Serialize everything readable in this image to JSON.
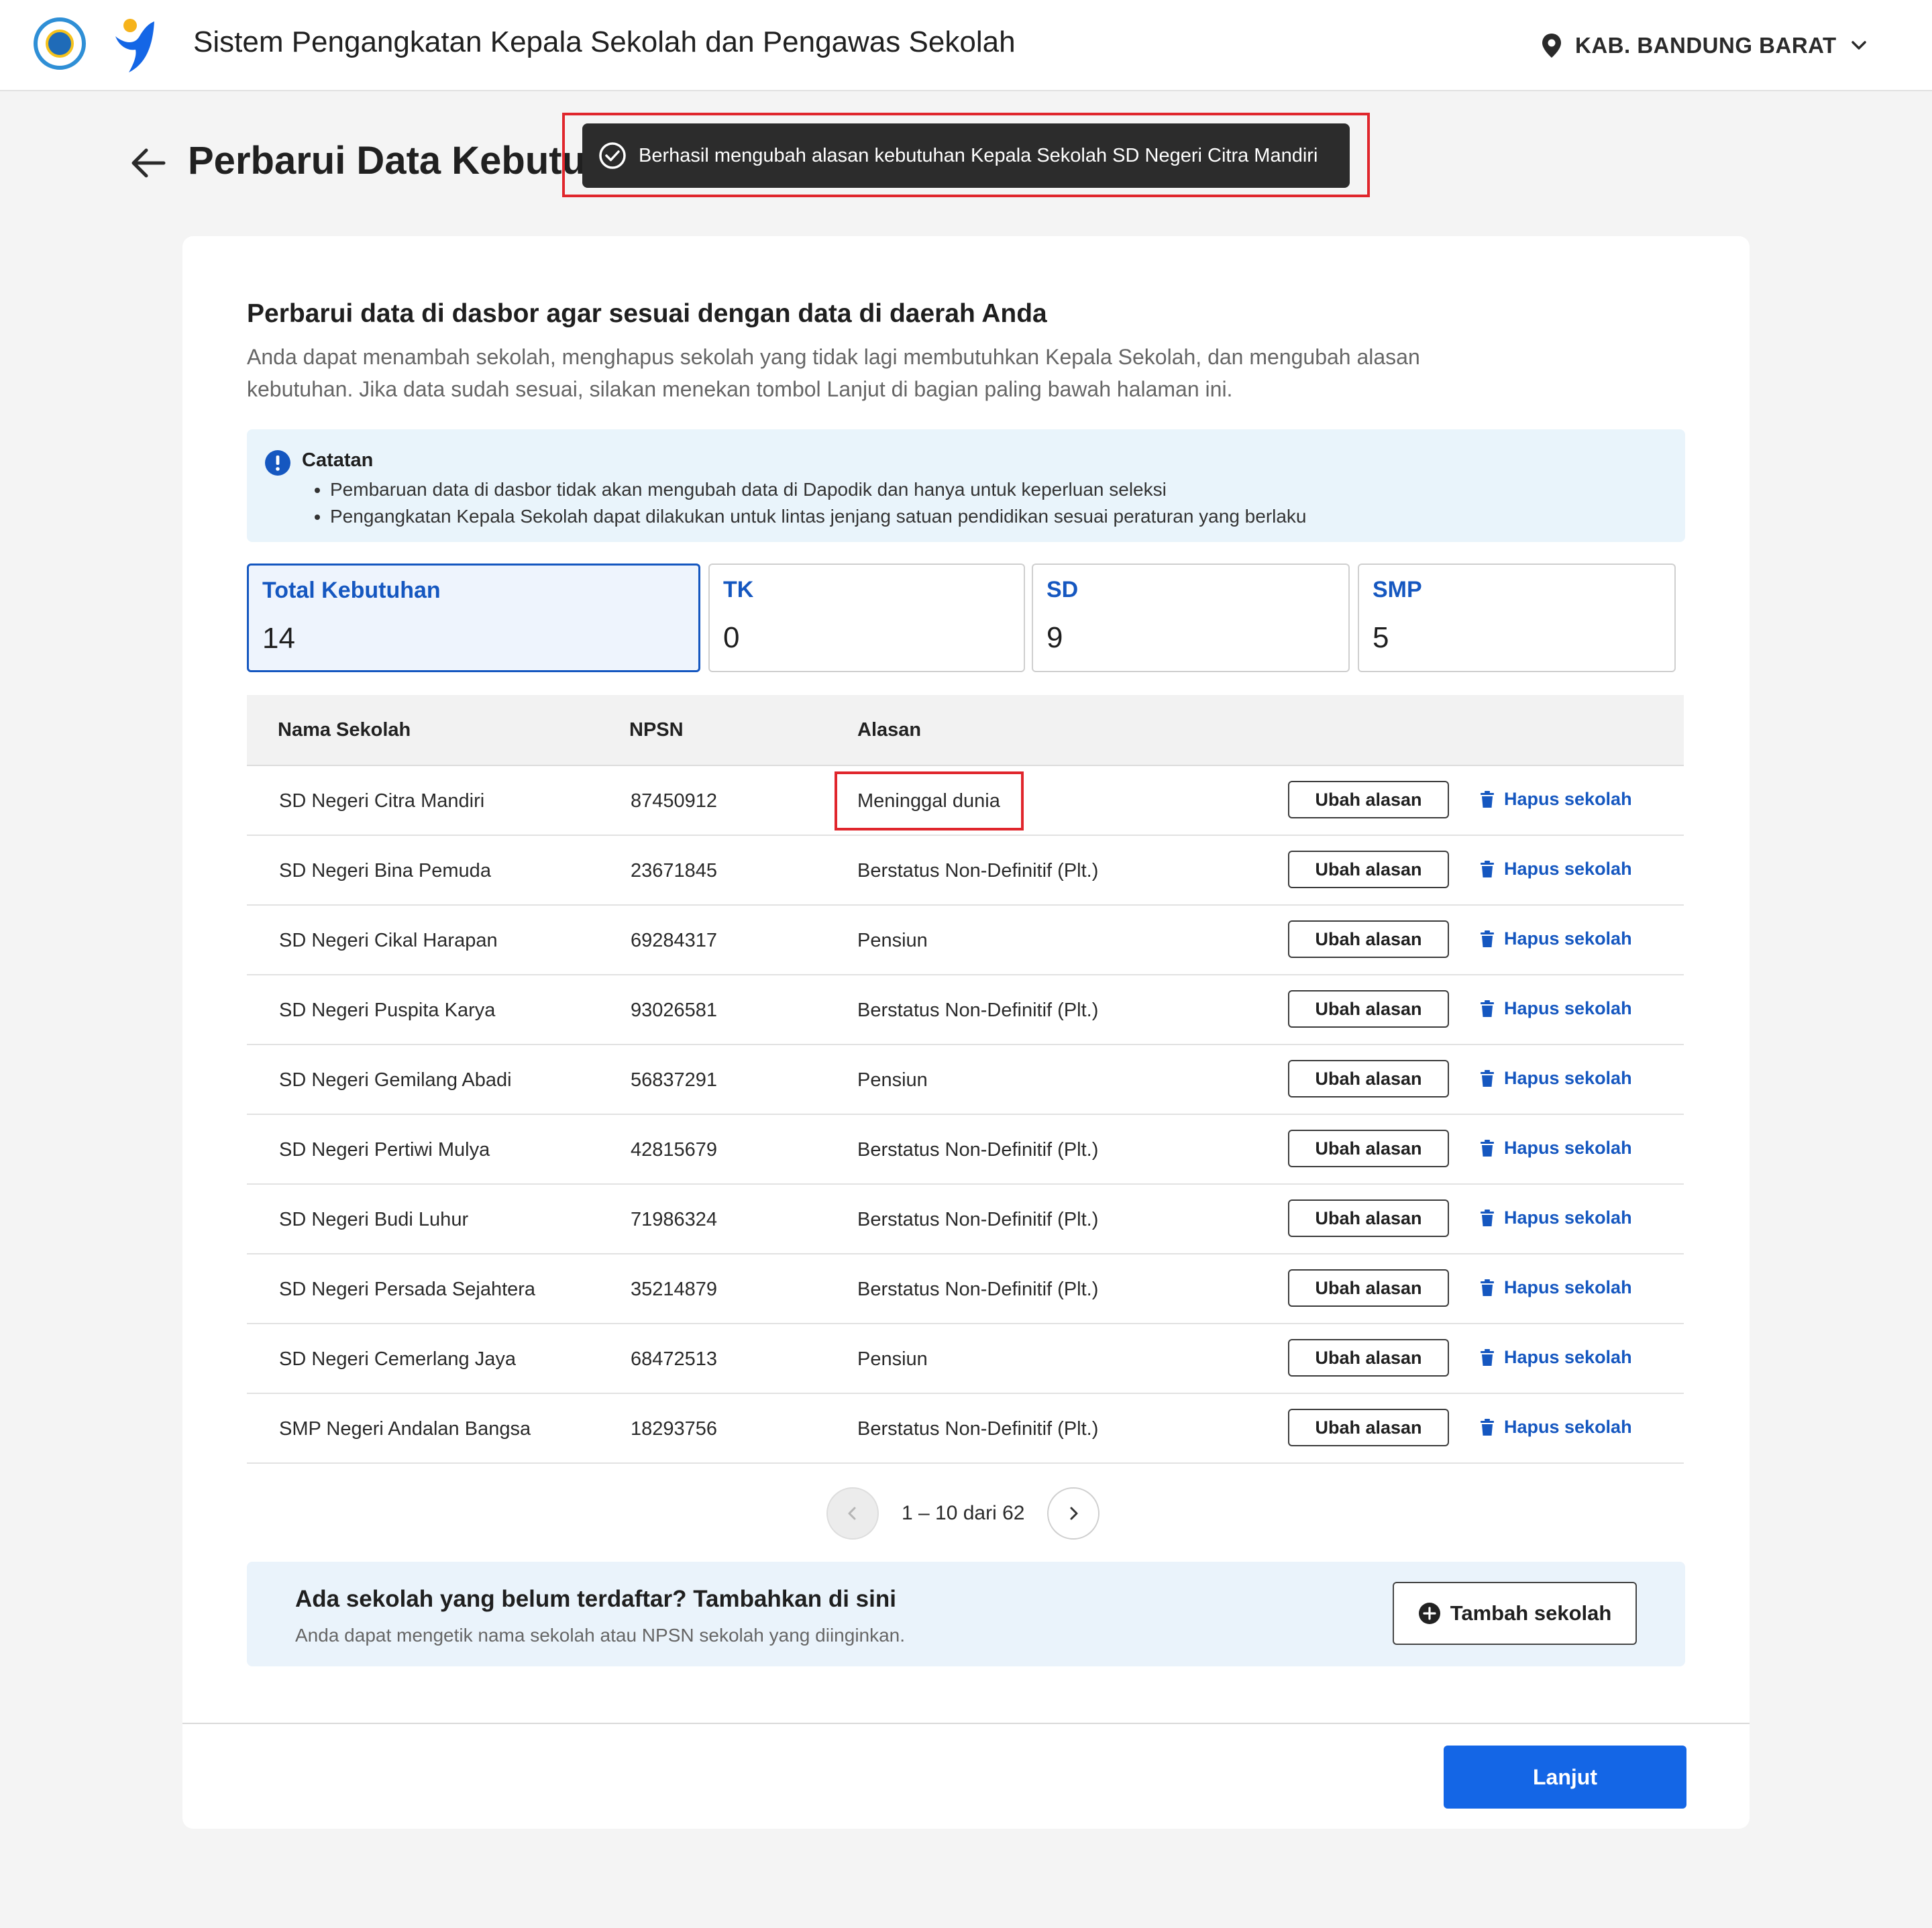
{
  "header": {
    "app_title": "Sistem Pengangkatan Kepala Sekolah dan Pengawas Sekolah",
    "region": "KAB. BANDUNG BARAT",
    "icons": [
      "kemendikbud-logo-icon",
      "app-logo-icon",
      "location-pin-icon",
      "chevron-down-icon"
    ]
  },
  "page": {
    "title": "Perbarui Data Kebutuhan",
    "back_icon": "arrow-left-icon"
  },
  "toast": {
    "message": "Berhasil mengubah alasan kebutuhan Kepala Sekolah SD Negeri Citra Mandiri",
    "icon": "check-circle-icon"
  },
  "card": {
    "title": "Perbarui data di dasbor agar sesuai dengan data di daerah Anda",
    "description": "Anda dapat menambah sekolah, menghapus sekolah yang tidak lagi membutuhkan Kepala Sekolah, dan mengubah alasan kebutuhan. Jika data sudah sesuai, silakan menekan tombol Lanjut di bagian paling bawah halaman ini."
  },
  "note": {
    "title": "Catatan",
    "items": [
      "Pembaruan data di dasbor tidak akan mengubah data di Dapodik dan hanya untuk keperluan seleksi",
      "Pengangkatan Kepala Sekolah dapat dilakukan untuk lintas jenjang satuan pendidikan sesuai peraturan yang berlaku"
    ]
  },
  "stats": [
    {
      "label": "Total Kebutuhan",
      "value": "14"
    },
    {
      "label": "TK",
      "value": "0"
    },
    {
      "label": "SD",
      "value": "9"
    },
    {
      "label": "SMP",
      "value": "5"
    }
  ],
  "table": {
    "headers": [
      "Nama Sekolah",
      "NPSN",
      "Alasan"
    ],
    "action_edit_label": "Ubah alasan",
    "action_delete_label": "Hapus sekolah",
    "rows": [
      {
        "name": "SD Negeri Citra Mandiri",
        "npsn": "87450912",
        "reason": "Meninggal dunia"
      },
      {
        "name": "SD Negeri Bina Pemuda",
        "npsn": "23671845",
        "reason": "Berstatus Non-Definitif (Plt.)"
      },
      {
        "name": "SD Negeri Cikal Harapan",
        "npsn": "69284317",
        "reason": "Pensiun"
      },
      {
        "name": "SD Negeri Puspita Karya",
        "npsn": "93026581",
        "reason": "Berstatus Non-Definitif (Plt.)"
      },
      {
        "name": "SD Negeri Gemilang Abadi",
        "npsn": "56837291",
        "reason": "Pensiun"
      },
      {
        "name": "SD Negeri Pertiwi Mulya",
        "npsn": "42815679",
        "reason": "Berstatus Non-Definitif (Plt.)"
      },
      {
        "name": "SD Negeri Budi Luhur",
        "npsn": "71986324",
        "reason": "Berstatus Non-Definitif (Plt.)"
      },
      {
        "name": "SD Negeri Persada Sejahtera",
        "npsn": "35214879",
        "reason": "Berstatus Non-Definitif (Plt.)"
      },
      {
        "name": "SD Negeri Cemerlang Jaya",
        "npsn": "68472513",
        "reason": "Pensiun"
      },
      {
        "name": "SMP Negeri Andalan Bangsa",
        "npsn": "18293756",
        "reason": "Berstatus Non-Definitif (Plt.)"
      }
    ]
  },
  "pagination": {
    "text": "1 – 10 dari 62"
  },
  "add_school": {
    "title": "Ada sekolah yang belum terdaftar? Tambahkan di sini",
    "description": "Anda dapat mengetik nama sekolah atau NPSN sekolah yang diinginkan.",
    "button_label": "Tambah sekolah"
  },
  "footer": {
    "next_label": "Lanjut"
  },
  "colors": {
    "primary": "#1466e6",
    "link": "#1557c0",
    "highlight": "#e0262c",
    "toast_bg": "#2c2c2c"
  }
}
